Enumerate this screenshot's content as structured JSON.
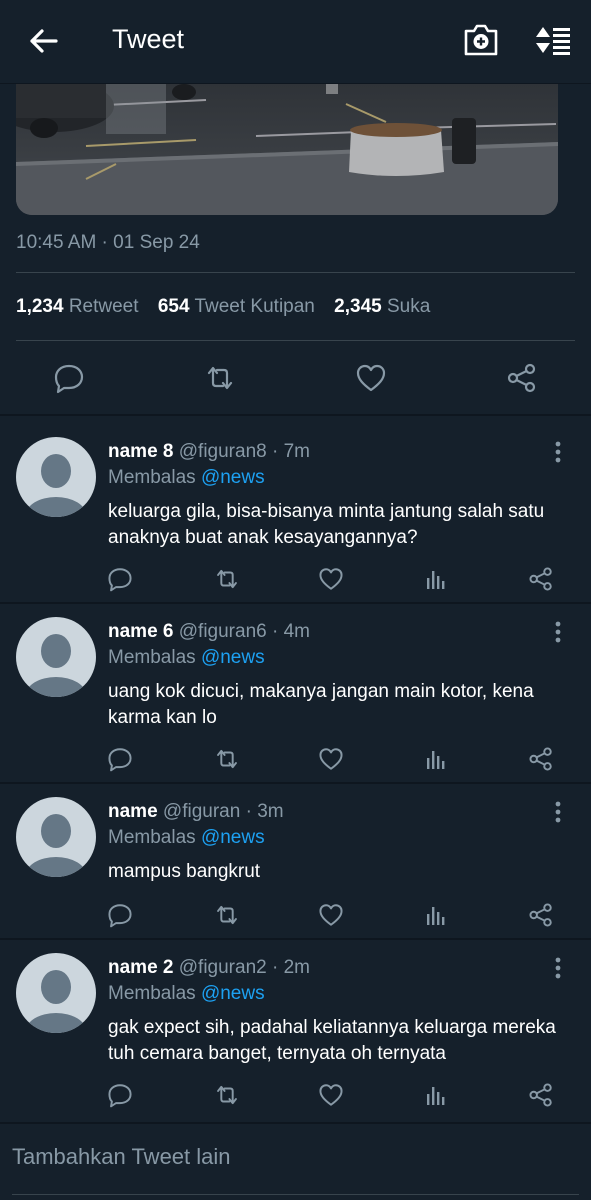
{
  "header": {
    "title": "Tweet",
    "back_icon": "arrow-left-icon",
    "camera_icon": "camera-plus-icon",
    "sort_icon": "sort-icon"
  },
  "tweet": {
    "timestamp": "10:45 AM · 01 Sep 24",
    "stats": [
      {
        "value": "1,234",
        "label": "Retweet"
      },
      {
        "value": "654",
        "label": "Tweet Kutipan"
      },
      {
        "value": "2,345",
        "label": "Suka"
      }
    ],
    "actions": [
      "reply-icon",
      "retweet-icon",
      "like-icon",
      "share-icon"
    ]
  },
  "replies": [
    {
      "name": "name 8",
      "handle": "@figuran8",
      "time": "· 7m",
      "replying_prefix": "Membalas",
      "replying_to": "@news",
      "text": "keluarga gila, bisa-bisanya minta jantung salah satu anaknya buat anak kesayangannya?"
    },
    {
      "name": "name 6",
      "handle": "@figuran6",
      "time": "· 4m",
      "replying_prefix": "Membalas",
      "replying_to": "@news",
      "text": "uang kok dicuci, makanya jangan main kotor, kena karma kan lo"
    },
    {
      "name": "name",
      "handle": "@figuran",
      "time": "· 3m",
      "replying_prefix": "Membalas",
      "replying_to": "@news",
      "text": "mampus bangkrut"
    },
    {
      "name": "name 2",
      "handle": "@figuran2",
      "time": "· 2m",
      "replying_prefix": "Membalas",
      "replying_to": "@news",
      "text": "gak expect sih, padahal keliatannya keluarga mereka tuh cemara banget, ternyata oh ternyata"
    }
  ],
  "compose": {
    "placeholder": "Tambahkan Tweet lain"
  },
  "colors": {
    "background": "#15202b",
    "secondary_text": "#8899a6",
    "accent": "#1da1f2",
    "divider": "#38444d"
  }
}
